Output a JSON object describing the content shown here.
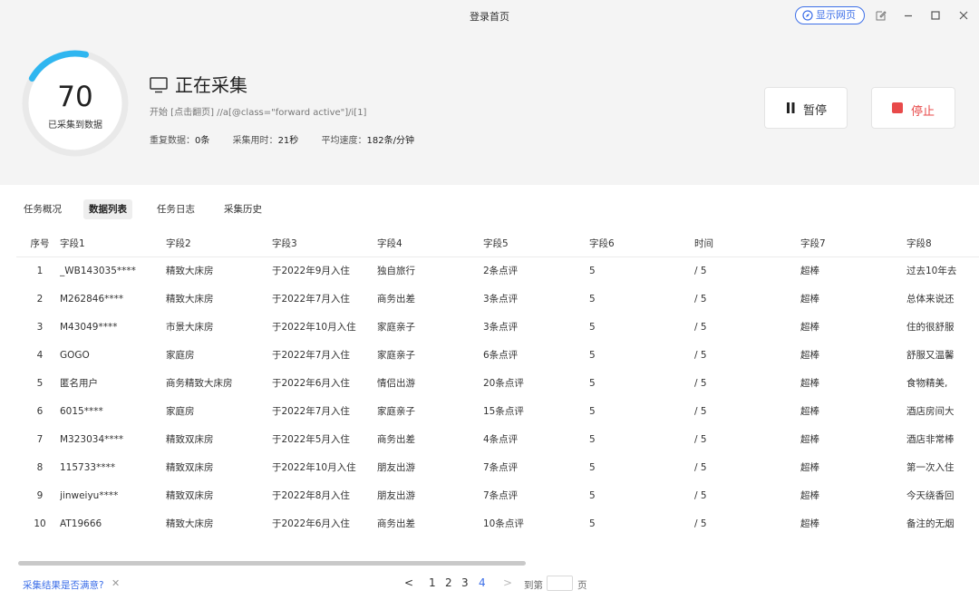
{
  "window": {
    "title": "登录首页",
    "show_web_label": "显示网页"
  },
  "progress": {
    "count": "70",
    "label": "已采集到数据",
    "fraction": 0.2
  },
  "status": {
    "title": "正在采集",
    "xpath": "开始 [点击翻页] //a[@class=\"forward active\"]/i[1]",
    "duplicate_label": "重复数据：",
    "duplicate_value": "0条",
    "elapsed_label": "采集用时：",
    "elapsed_value": "21秒",
    "speed_label": "平均速度：",
    "speed_value": "182条/分钟"
  },
  "actions": {
    "pause_label": "暂停",
    "stop_label": "停止"
  },
  "colors": {
    "accent": "#3d6fe8",
    "stop": "#e84a4a",
    "ring": "#2fb6f0"
  },
  "tabs": [
    {
      "label": "任务概况"
    },
    {
      "label": "数据列表",
      "active": true
    },
    {
      "label": "任务日志"
    },
    {
      "label": "采集历史"
    }
  ],
  "table": {
    "headers": [
      "序号",
      "字段1",
      "字段2",
      "字段3",
      "字段4",
      "字段5",
      "字段6",
      "时间",
      "字段7",
      "字段8"
    ],
    "rows": [
      [
        "1",
        "_WB143035****",
        "精致大床房",
        "于2022年9月入住",
        "独自旅行",
        "2条点评",
        "5",
        "/ 5",
        "超棒",
        "过去10年去"
      ],
      [
        "2",
        "M262846****",
        "精致大床房",
        "于2022年7月入住",
        "商务出差",
        "3条点评",
        "5",
        "/ 5",
        "超棒",
        "总体来说还"
      ],
      [
        "3",
        "M43049****",
        "市景大床房",
        "于2022年10月入住",
        "家庭亲子",
        "3条点评",
        "5",
        "/ 5",
        "超棒",
        "住的很舒服"
      ],
      [
        "4",
        "GOGO",
        "家庭房",
        "于2022年7月入住",
        "家庭亲子",
        "6条点评",
        "5",
        "/ 5",
        "超棒",
        "舒服又温馨"
      ],
      [
        "5",
        "匿名用户",
        "商务精致大床房",
        "于2022年6月入住",
        "情侣出游",
        "20条点评",
        "5",
        "/ 5",
        "超棒",
        "食物精美,"
      ],
      [
        "6",
        "6015****",
        "家庭房",
        "于2022年7月入住",
        "家庭亲子",
        "15条点评",
        "5",
        "/ 5",
        "超棒",
        "酒店房间大"
      ],
      [
        "7",
        "M323034****",
        "精致双床房",
        "于2022年5月入住",
        "商务出差",
        "4条点评",
        "5",
        "/ 5",
        "超棒",
        "酒店非常棒"
      ],
      [
        "8",
        "115733****",
        "精致双床房",
        "于2022年10月入住",
        "朋友出游",
        "7条点评",
        "5",
        "/ 5",
        "超棒",
        "第一次入住"
      ],
      [
        "9",
        "jinweiyu****",
        "精致双床房",
        "于2022年8月入住",
        "朋友出游",
        "7条点评",
        "5",
        "/ 5",
        "超棒",
        "今天绕香回"
      ],
      [
        "10",
        "AT19666",
        "精致大床房",
        "于2022年6月入住",
        "商务出差",
        "10条点评",
        "5",
        "/ 5",
        "超棒",
        "备注的无烟"
      ]
    ]
  },
  "footer": {
    "feedback": "采集结果是否满意?",
    "close_glyph": "✕",
    "prev_glyph": "<",
    "next_glyph": ">",
    "pages": [
      "1",
      "2",
      "3",
      "4"
    ],
    "current_page": "4",
    "goto_label": "到第",
    "goto_unit": "页"
  }
}
